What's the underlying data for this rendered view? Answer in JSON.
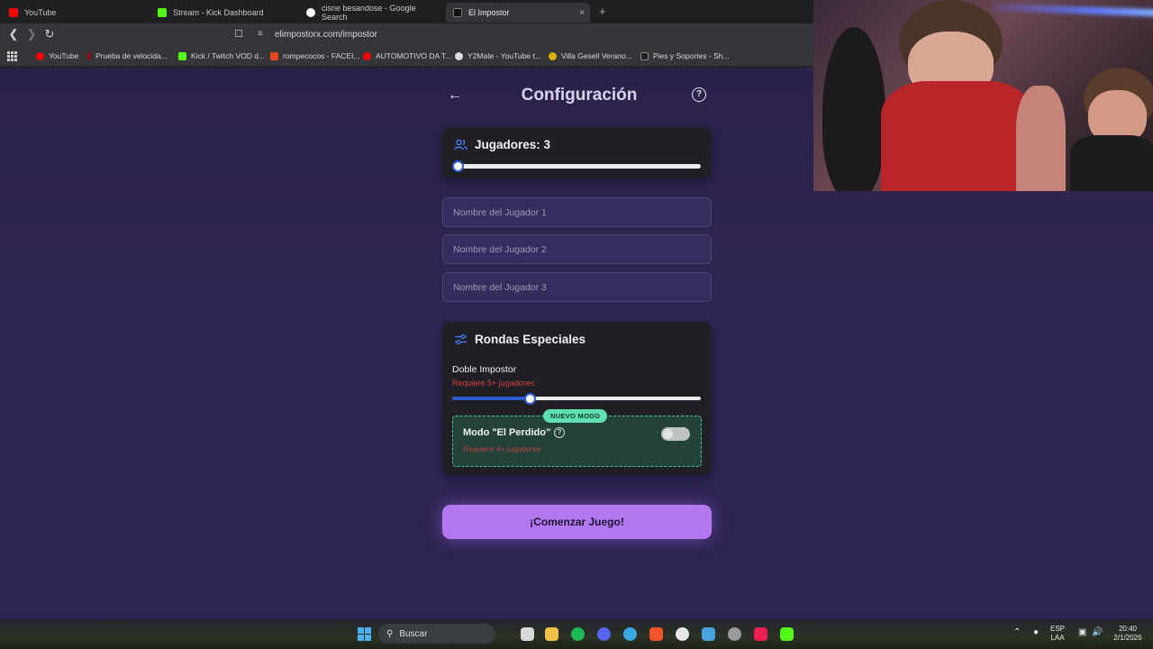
{
  "browser": {
    "tabs": [
      {
        "label": "YouTube",
        "icon": "youtube-icon",
        "color": "#ff0000"
      },
      {
        "label": "Stream - Kick Dashboard",
        "icon": "kick-icon",
        "color": "#53fc18"
      },
      {
        "label": "cisne besandose - Google Search",
        "icon": "google-icon",
        "color": "#ffffff"
      },
      {
        "label": "El Impostor",
        "icon": "impostor-icon",
        "color": "#111111"
      }
    ],
    "tab_close": "×",
    "new_tab": "+",
    "url": "elimpostorx.com/impostor",
    "bookmarks": [
      {
        "label": "YouTube",
        "color": "#ff0000"
      },
      {
        "label": "Prueba de velocida...",
        "color": "#8a0f14"
      },
      {
        "label": "Kick / Twitch VOD d...",
        "color": "#53fc18"
      },
      {
        "label": "rompecocos - FACEI...",
        "color": "#e8481c"
      },
      {
        "label": "AUTOMOTIVO DA T...",
        "color": "#ff0000"
      },
      {
        "label": "Y2Mate - YouTube t...",
        "color": "#dddddd"
      },
      {
        "label": "Villa Gesell Verano...",
        "color": "#d9b100"
      },
      {
        "label": "Pies y Soportes - Sh...",
        "color": "#222222"
      }
    ]
  },
  "app": {
    "title": "Configuración",
    "players": {
      "label": "Jugadores: 3",
      "count": 3,
      "slider_fraction": 0.0
    },
    "player_inputs": [
      {
        "placeholder": "Nombre del Jugador 1"
      },
      {
        "placeholder": "Nombre del Jugador 2"
      },
      {
        "placeholder": "Nombre del Jugador 3"
      }
    ],
    "special": {
      "title": "Rondas Especiales",
      "double_impostor": {
        "label": "Doble Impostor",
        "requirement": "Requiere 5+ jugadores",
        "slider_fraction": 0.31
      },
      "lost_mode": {
        "badge": "NUEVO MODO",
        "title": "Modo \"El Perdido\"",
        "help": "?",
        "requirement": "Requiere 4+ jugadores",
        "enabled": false
      }
    },
    "start_button": "¡Comenzar Juego!"
  },
  "taskbar": {
    "search_label": "Buscar",
    "language": "ESP",
    "keyboard": "LAA",
    "time": "20:40",
    "date": "2/1/2026"
  },
  "colors": {
    "accent": "#b378f0",
    "slider_blue": "#2f5bd0",
    "new_mode_green": "#5fe0b0",
    "warning_red": "#d24444"
  }
}
